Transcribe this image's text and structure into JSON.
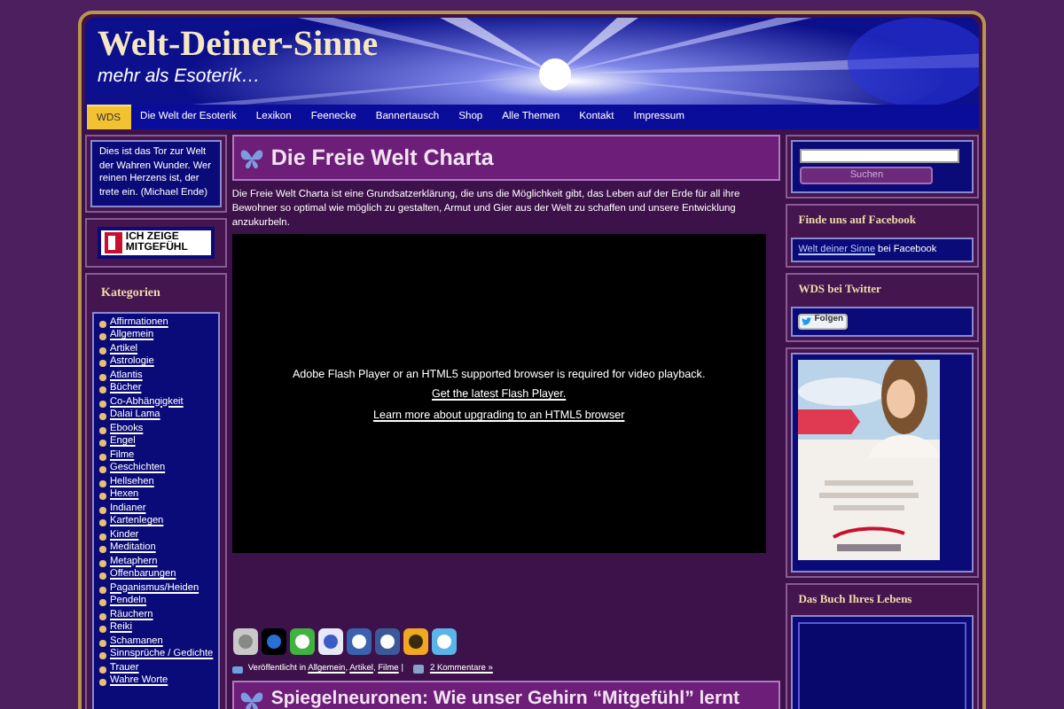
{
  "header": {
    "title": "Welt-Deiner-Sinne",
    "tagline": "mehr als Esoterik…"
  },
  "nav": [
    {
      "label": "WDS",
      "selected": true
    },
    {
      "label": "Die Welt der Esoterik",
      "selected": false
    },
    {
      "label": "Lexikon",
      "selected": false
    },
    {
      "label": "Feenecke",
      "selected": false
    },
    {
      "label": "Bannertausch",
      "selected": false
    },
    {
      "label": "Shop",
      "selected": false
    },
    {
      "label": "Alle Themen",
      "selected": false
    },
    {
      "label": "Kontakt",
      "selected": false
    },
    {
      "label": "Impressum",
      "selected": false
    }
  ],
  "left": {
    "quote": "Dies ist das Tor zur Welt der Wahren Wunder. Wer reinen Herzens ist, der trete ein. (Michael Ende)",
    "badge": [
      "ICH ZEIGE",
      "MITGEFÜHL"
    ],
    "categories_title": "Kategorien",
    "categories": [
      "Affirmationen",
      "Allgemein",
      "Artikel",
      "Astrologie",
      "Atlantis",
      "Bücher",
      "Co-Abhängigkeit",
      "Dalai Lama",
      "Ebooks",
      "Engel",
      "Filme",
      "Geschichten",
      "Hellsehen",
      "Hexen",
      "Indianer",
      "Kartenlegen",
      "Kinder",
      "Meditation",
      "Metaphern",
      "Offenbarungen",
      "Paganismus/Heiden",
      "Pendeln",
      "Räuchern",
      "Reiki",
      "Schamanen",
      "Sinnsprüche / Gedichte",
      "Trauer",
      "Wahre Worte"
    ]
  },
  "post": {
    "title": "Die Freie Welt Charta",
    "intro": "Die Freie Welt Charta ist eine Grundsatzerklärung, die uns die Möglichkeit gibt, das Leben auf der Erde für all ihre Bewohner so optimal wie möglich zu gestalten, Armut und Gier aus der Welt zu schaffen und unsere Entwicklung anzukurbeln.",
    "video": {
      "message": "Adobe Flash Player or an HTML5 supported browser is required for video playback.",
      "links": [
        "Get the latest Flash Player.",
        "Learn more about upgrading to an HTML5 browser"
      ]
    },
    "meta": {
      "prefix": "Veröffentlicht in",
      "categories": [
        "Allgemein",
        "Artikel",
        "Filme"
      ],
      "list_separator": ",",
      "divider": "|",
      "comments": "2 Kommentare »"
    }
  },
  "next_post": {
    "title": "Spiegelneuronen: Wie unser Gehirn “Mitgefühl” lernt"
  },
  "right": {
    "search": {
      "button": "Suchen"
    },
    "facebook": {
      "title": "Finde uns auf Facebook",
      "link": "Welt deiner Sinne",
      "suffix": "bei Facebook"
    },
    "twitter": {
      "title": "WDS bei Twitter",
      "button": "Folgen"
    },
    "book": {
      "title": "Das Buch Ihres Lebens"
    }
  }
}
